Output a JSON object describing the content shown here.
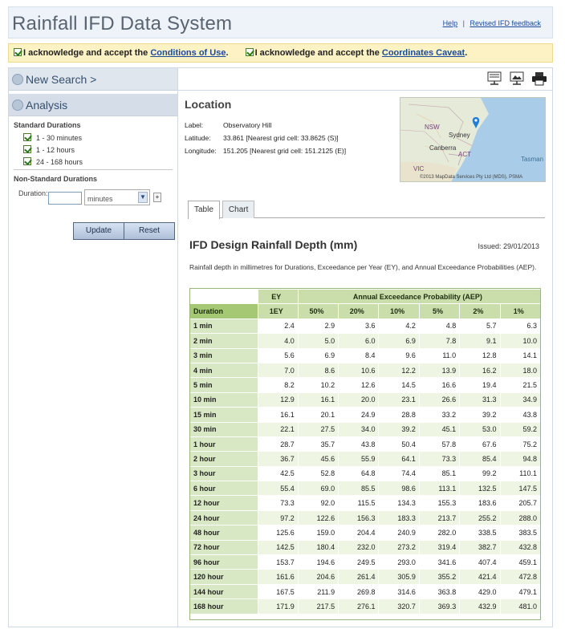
{
  "header": {
    "title": "Rainfall IFD Data System",
    "help_label": "Help",
    "separator": "|",
    "feedback_label": "Revised IFD feedback"
  },
  "acknowledge": {
    "text1": "I acknowledge and accept the ",
    "link1": "Conditions of Use",
    "text2": "I acknowledge and accept the ",
    "link2": "Coordinates Caveat",
    "period": "."
  },
  "sidebar": {
    "new_search": "New Search >",
    "analysis": "Analysis",
    "standard_label": "Standard Durations",
    "standard": [
      "1 - 30 minutes",
      "1 - 12 hours",
      "24 - 168 hours"
    ],
    "non_standard_label": "Non-Standard Durations",
    "duration_label": "Duration:",
    "duration_value": "",
    "unit_selected": "minutes",
    "plus": "+",
    "update": "Update",
    "reset": "Reset"
  },
  "toolbar": {
    "icons": [
      "export-csv-icon",
      "export-image-icon",
      "print-icon"
    ]
  },
  "location": {
    "title": "Location",
    "label_key": "Label:",
    "label_value": "Observatory Hill",
    "lat_key": "Latitude:",
    "lat_value": "33.861 [Nearest grid cell: 33.8625 (S)]",
    "lon_key": "Longitude:",
    "lon_value": "151.205 [Nearest grid cell: 151.2125 (E)]"
  },
  "map": {
    "labels": [
      "NSW",
      "Sydney",
      "Canberra",
      "ACT",
      "Tasman",
      "VIC"
    ],
    "credit": "©2013 MapData Services Pty Ltd (MDS), PSMA"
  },
  "tabs": [
    {
      "label": "Table",
      "active": true
    },
    {
      "label": "Chart",
      "active": false
    }
  ],
  "ifd": {
    "title": "IFD Design Rainfall Depth (mm)",
    "issued": "Issued: 29/01/2013",
    "description": "Rainfall depth in millimetres for Durations, Exceedance per Year (EY), and Annual Exceedance Probabilities (AEP).",
    "group_headers": {
      "ey": "EY",
      "aep": "Annual Exceedance Probability (AEP)"
    },
    "columns": [
      "Duration",
      "1EY",
      "50%",
      "20%",
      "10%",
      "5%",
      "2%",
      "1%"
    ],
    "rows": [
      [
        "1 min",
        "2.4",
        "2.9",
        "3.6",
        "4.2",
        "4.8",
        "5.7",
        "6.3"
      ],
      [
        "2 min",
        "4.0",
        "5.0",
        "6.0",
        "6.9",
        "7.8",
        "9.1",
        "10.0"
      ],
      [
        "3 min",
        "5.6",
        "6.9",
        "8.4",
        "9.6",
        "11.0",
        "12.8",
        "14.1"
      ],
      [
        "4 min",
        "7.0",
        "8.6",
        "10.6",
        "12.2",
        "13.9",
        "16.2",
        "18.0"
      ],
      [
        "5 min",
        "8.2",
        "10.2",
        "12.6",
        "14.5",
        "16.6",
        "19.4",
        "21.5"
      ],
      [
        "10 min",
        "12.9",
        "16.1",
        "20.0",
        "23.1",
        "26.6",
        "31.3",
        "34.9"
      ],
      [
        "15 min",
        "16.1",
        "20.1",
        "24.9",
        "28.8",
        "33.2",
        "39.2",
        "43.8"
      ],
      [
        "30 min",
        "22.1",
        "27.5",
        "34.0",
        "39.2",
        "45.1",
        "53.0",
        "59.2"
      ],
      [
        "1 hour",
        "28.7",
        "35.7",
        "43.8",
        "50.4",
        "57.8",
        "67.6",
        "75.2"
      ],
      [
        "2 hour",
        "36.7",
        "45.6",
        "55.9",
        "64.1",
        "73.3",
        "85.4",
        "94.8"
      ],
      [
        "3 hour",
        "42.5",
        "52.8",
        "64.8",
        "74.4",
        "85.1",
        "99.2",
        "110.1"
      ],
      [
        "6 hour",
        "55.4",
        "69.0",
        "85.5",
        "98.6",
        "113.1",
        "132.5",
        "147.5"
      ],
      [
        "12 hour",
        "73.3",
        "92.0",
        "115.5",
        "134.3",
        "155.3",
        "183.6",
        "205.7"
      ],
      [
        "24 hour",
        "97.2",
        "122.6",
        "156.3",
        "183.3",
        "213.7",
        "255.2",
        "288.0"
      ],
      [
        "48 hour",
        "125.6",
        "159.0",
        "204.4",
        "240.9",
        "282.0",
        "338.5",
        "383.5"
      ],
      [
        "72 hour",
        "142.5",
        "180.4",
        "232.0",
        "273.2",
        "319.4",
        "382.7",
        "432.8"
      ],
      [
        "96 hour",
        "153.7",
        "194.6",
        "249.5",
        "293.0",
        "341.6",
        "407.4",
        "459.1"
      ],
      [
        "120 hour",
        "161.6",
        "204.6",
        "261.4",
        "305.9",
        "355.2",
        "421.4",
        "472.8"
      ],
      [
        "144 hour",
        "167.5",
        "211.9",
        "269.8",
        "314.6",
        "363.8",
        "429.0",
        "479.1"
      ],
      [
        "168 hour",
        "171.9",
        "217.5",
        "276.1",
        "320.7",
        "369.3",
        "432.9",
        "481.0"
      ]
    ]
  },
  "colors": {
    "header_green": "#a4c873",
    "duration_green": "#d9e8c4",
    "link_blue": "#1a4a9c",
    "ack_bg": "#fcf2c4"
  }
}
